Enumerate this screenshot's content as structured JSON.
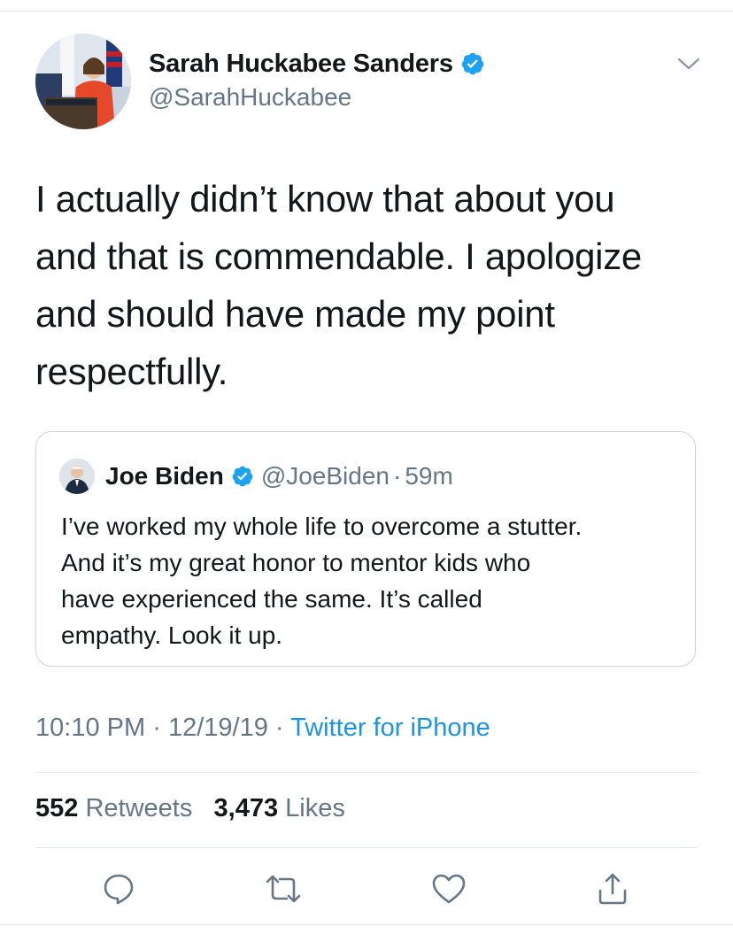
{
  "tweet": {
    "author_name": "Sarah Huckabee Sanders",
    "author_handle": "@SarahHuckabee",
    "text_lines": [
      "I actually didn’t know that about you",
      "and that is commendable. I apologize",
      "and should have made my point",
      "respectfully."
    ],
    "time": "10:10 PM",
    "date": "12/19/19",
    "source": "Twitter for iPhone",
    "retweets_count": "552",
    "retweets_label": "Retweets",
    "likes_count": "3,473",
    "likes_label": "Likes"
  },
  "quoted": {
    "author_name": "Joe Biden",
    "author_handle": "@JoeBiden",
    "time_ago": "59m",
    "text_lines": [
      "I’ve worked my whole life to overcome a stutter.",
      "And it’s my great honor to mentor kids who",
      "have experienced the same. It’s called",
      "empathy. Look it up."
    ]
  },
  "separator": "·",
  "icons": {
    "verified": "verified-badge-icon",
    "menu": "chevron-down-icon",
    "reply": "reply-icon",
    "retweet": "retweet-icon",
    "like": "heart-icon",
    "share": "share-icon"
  },
  "colors": {
    "accent": "#1b95e0",
    "verified": "#1da1f2",
    "secondary_text": "#657786",
    "border": "#e1e8ed"
  }
}
